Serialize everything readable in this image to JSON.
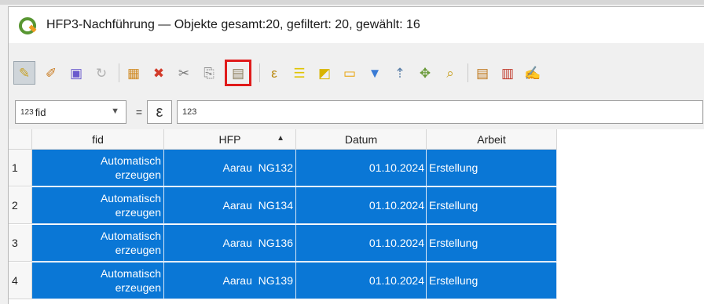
{
  "window": {
    "title": "HFP3-Nachführung — Objekte gesamt:20, gefiltert: 20, gewählt: 16"
  },
  "toolbar": {
    "buttons": [
      {
        "name": "toggle-editing-icon",
        "glyph": "✎",
        "color": "#c9a227"
      },
      {
        "name": "toggle-multi-edit-icon",
        "glyph": "✐",
        "color": "#c97a1e"
      },
      {
        "name": "save-edits-icon",
        "glyph": "▣",
        "color": "#6a5acd"
      },
      {
        "name": "reload-icon",
        "glyph": "↻",
        "color": "#b0b0b0"
      },
      {
        "name": "add-feature-icon",
        "glyph": "▦",
        "color": "#d08a22"
      },
      {
        "name": "delete-selected-icon",
        "glyph": "🗑",
        "color": "#d23b2a"
      },
      {
        "name": "cut-icon",
        "glyph": "✂",
        "color": "#777777"
      },
      {
        "name": "copy-icon",
        "glyph": "⎘",
        "color": "#888888"
      },
      {
        "name": "paste-icon",
        "glyph": "📋",
        "color": "#8b7d5c"
      },
      {
        "name": "expression-select-icon",
        "glyph": "ε",
        "color": "#b8860b"
      },
      {
        "name": "select-all-icon",
        "glyph": "☰",
        "color": "#e0c400"
      },
      {
        "name": "invert-selection-icon",
        "glyph": "◩",
        "color": "#d8b400"
      },
      {
        "name": "deselect-all-icon",
        "glyph": "▭",
        "color": "#e8a000"
      },
      {
        "name": "filter-select-icon",
        "glyph": "⏷",
        "color": "#3a7bd5"
      },
      {
        "name": "move-selection-top-icon",
        "glyph": "⇡",
        "color": "#5a7fa8"
      },
      {
        "name": "pan-to-selected-icon",
        "glyph": "✥",
        "color": "#6a9a3a"
      },
      {
        "name": "zoom-to-selected-icon",
        "glyph": "⌕",
        "color": "#c9a227"
      },
      {
        "name": "new-field-icon",
        "glyph": "▤",
        "color": "#c07a20"
      },
      {
        "name": "delete-field-icon",
        "glyph": "▥",
        "color": "#c0392b"
      },
      {
        "name": "field-calculator-icon",
        "glyph": "✍",
        "color": "#5555aa"
      }
    ]
  },
  "expression": {
    "field_type": "123",
    "field_name": "fid",
    "equals": "=",
    "epsilon": "ε",
    "value": "123"
  },
  "table": {
    "columns": [
      "fid",
      "HFP",
      "Datum",
      "Arbeit"
    ],
    "sort_column": "HFP",
    "rows": [
      {
        "num": "1",
        "fid_line1": "Automatisch",
        "fid_line2": "erzeugen",
        "hfp": "Aarau  NG132",
        "datum": "01.10.2024",
        "arbeit": "Erstellung"
      },
      {
        "num": "2",
        "fid_line1": "Automatisch",
        "fid_line2": "erzeugen",
        "hfp": "Aarau  NG134",
        "datum": "01.10.2024",
        "arbeit": "Erstellung"
      },
      {
        "num": "3",
        "fid_line1": "Automatisch",
        "fid_line2": "erzeugen",
        "hfp": "Aarau  NG136",
        "datum": "01.10.2024",
        "arbeit": "Erstellung"
      },
      {
        "num": "4",
        "fid_line1": "Automatisch",
        "fid_line2": "erzeugen",
        "hfp": "Aarau  NG139",
        "datum": "01.10.2024",
        "arbeit": "Erstellung"
      }
    ]
  },
  "colors": {
    "selection": "#0a77d6",
    "highlight_border": "#e01b1b",
    "qgis_green": "#589632"
  }
}
